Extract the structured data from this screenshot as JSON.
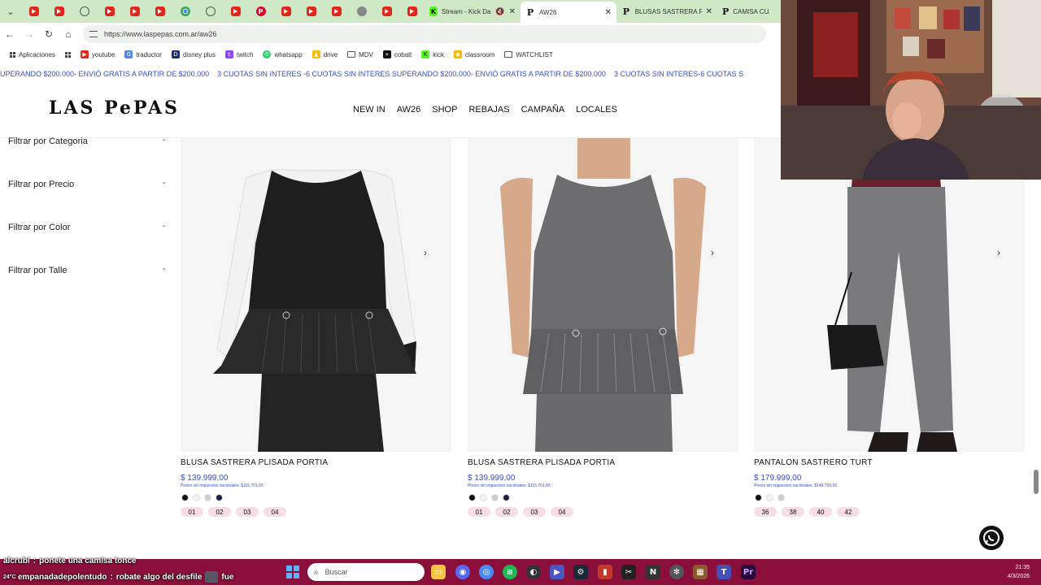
{
  "browser": {
    "active_tab_title": "AW26",
    "tabs": [
      {
        "title": "Stream - Kick Dashb",
        "icon": "kick-icon"
      },
      {
        "title": "AW26",
        "icon": "laspepas-icon"
      },
      {
        "title": "BLUSAS SASTRERA P",
        "icon": "laspepas-icon"
      },
      {
        "title": "CAMISA CUADRILLE",
        "icon": "laspepas-icon"
      }
    ],
    "url": "https://www.laspepas.com.ar/aw26",
    "bookmarks": [
      {
        "label": "Aplicaciones",
        "icon": "apps-grid-icon"
      },
      {
        "label": "youtube",
        "icon": "youtube-icon",
        "color": "#e1261c"
      },
      {
        "label": "traductor",
        "icon": "translate-icon",
        "color": "#4a8af4"
      },
      {
        "label": "disney plus",
        "icon": "disney-icon",
        "color": "#1b2d6b"
      },
      {
        "label": "twitch",
        "icon": "twitch-icon",
        "color": "#9146ff"
      },
      {
        "label": "whatsapp",
        "icon": "whatsapp-icon",
        "color": "#25d366"
      },
      {
        "label": "drive",
        "icon": "drive-icon",
        "color": "#fbbc04"
      },
      {
        "label": "MDV",
        "icon": "folder-icon"
      },
      {
        "label": "cobalt",
        "icon": "cobalt-icon",
        "color": "#111111"
      },
      {
        "label": "kick",
        "icon": "kick-icon",
        "color": "#53fc18"
      },
      {
        "label": "classroom",
        "icon": "classroom-icon",
        "color": "#f4b400"
      },
      {
        "label": "WATCHLIST",
        "icon": "folder-icon"
      }
    ]
  },
  "site": {
    "promo": [
      "UPERANDO $200.000- ENVIÓ GRATIS A PARTIR DE $200.000",
      "3 CUOTAS SIN INTERES -6 CUOTAS SIN INTERES SUPERANDO $200.000- ENVIÓ GRATIS A PARTIR DE $200.000",
      "3 CUOTAS SIN INTERES-6 CUOTAS S"
    ],
    "logo": "LAS PePAS",
    "nav": [
      "NEW IN",
      "AW26",
      "SHOP",
      "REBAJAS",
      "CAMPAÑA",
      "LOCALES"
    ],
    "filters": [
      "Filtrar por Categoria",
      "Filtrar por Precio",
      "Filtrar por Color",
      "Filtrar por Talle"
    ],
    "products": [
      {
        "name": "BLUSA SASTRERA PLISADA PORTIA",
        "price": "$ 139.999,00",
        "tax_note": "Precio sin impuestos nacionales: $115.701,65",
        "colors": [
          "#111111",
          "#f3f3f3",
          "#cccccc",
          "#1a1f4a"
        ],
        "sizes": [
          "01",
          "02",
          "03",
          "04"
        ]
      },
      {
        "name": "BLUSA SASTRERA PLISADA PORTIA",
        "price": "$ 139.999,00",
        "tax_note": "Precio sin impuestos nacionales: $115.701,65",
        "colors": [
          "#111111",
          "#f3f3f3",
          "#cccccc",
          "#1a1f4a"
        ],
        "sizes": [
          "01",
          "02",
          "03",
          "04"
        ]
      },
      {
        "name": "PANTALON SASTRERO TURT",
        "price": "$ 179.999,00",
        "tax_note": "Precio sin impuestos nacionales: $148.759,50",
        "colors": [
          "#111111",
          "#f3f3f3",
          "#cccccc"
        ],
        "sizes": [
          "36",
          "38",
          "40",
          "42"
        ]
      }
    ]
  },
  "chat": [
    {
      "user": "alcrubi",
      "message": "ponete una camisa tonce"
    },
    {
      "user": "empanadadepolentudo",
      "message": "robate algo del desfile",
      "emote": "emote-image",
      "tail": "fue"
    }
  ],
  "taskbar": {
    "search_placeholder": "Buscar",
    "time": "21:35",
    "date": "4/3/2026",
    "weather": "24°C"
  }
}
